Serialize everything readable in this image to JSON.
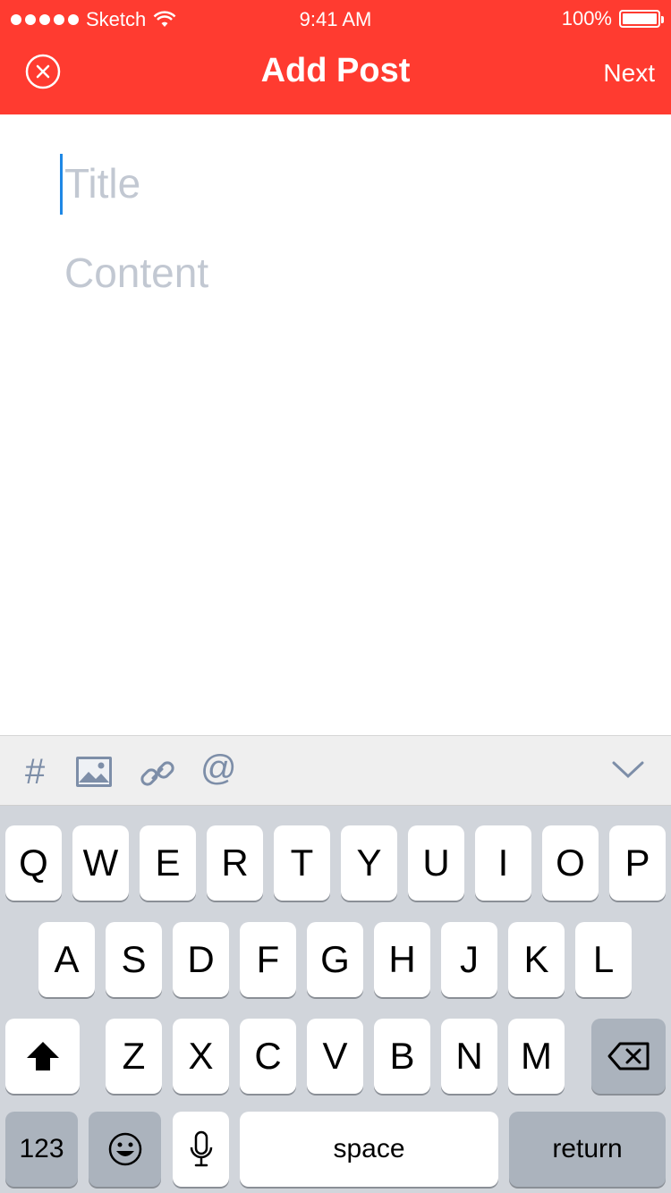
{
  "status_bar": {
    "carrier": "Sketch",
    "time": "9:41 AM",
    "battery": "100%"
  },
  "nav": {
    "title": "Add Post",
    "next_label": "Next",
    "close_icon": "close-circle-icon"
  },
  "editor": {
    "title_placeholder": "Title",
    "content_placeholder": "Content"
  },
  "toolbar": {
    "icons": [
      "hashtag-icon",
      "image-icon",
      "link-icon",
      "mention-icon",
      "chevron-down-icon"
    ],
    "hash": "#",
    "at": "@"
  },
  "keyboard": {
    "row1": [
      "Q",
      "W",
      "E",
      "R",
      "T",
      "Y",
      "U",
      "I",
      "O",
      "P"
    ],
    "row2": [
      "A",
      "S",
      "D",
      "F",
      "G",
      "H",
      "J",
      "K",
      "L"
    ],
    "row3": [
      "Z",
      "X",
      "C",
      "V",
      "B",
      "N",
      "M"
    ],
    "numbers_label": "123",
    "space_label": "space",
    "return_label": "return"
  },
  "colors": {
    "accent": "#ff3b30",
    "placeholder": "#c2c8d2",
    "caret": "#1e88e5",
    "toolbar_icon": "#7d8ea8"
  }
}
